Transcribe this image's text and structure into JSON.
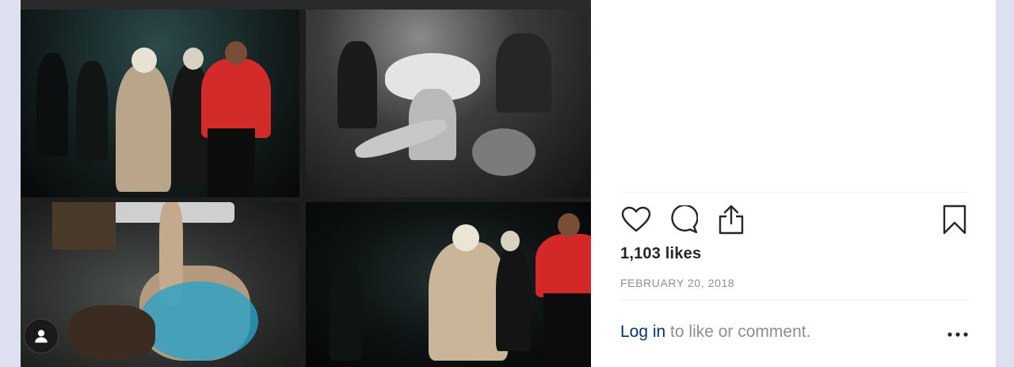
{
  "post": {
    "photo_alt": "",
    "likes": "1,103 likes",
    "date": "FEBRUARY 20, 2018",
    "login_link": "Log in",
    "login_suffix": " to like or comment."
  },
  "icons": {
    "like": "heart-icon",
    "comment": "comment-icon",
    "share": "share-icon",
    "save": "bookmark-icon",
    "more": "more-options-icon",
    "avatar": "user-icon"
  },
  "colors": {
    "background": "#dde0f0",
    "panel": "#ffffff",
    "text": "#262626",
    "muted": "#8e8e8e",
    "link": "#003569"
  }
}
